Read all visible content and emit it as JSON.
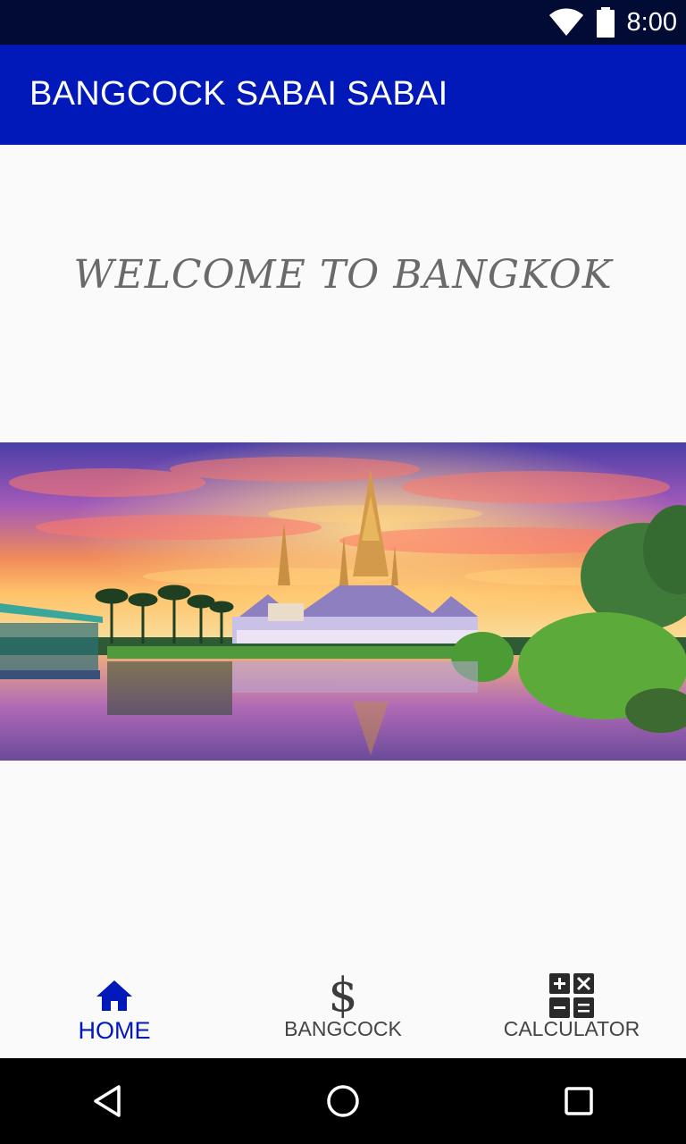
{
  "status_bar": {
    "time": "8:00",
    "icons": [
      "wifi-icon",
      "battery-icon"
    ]
  },
  "app_bar": {
    "title": "BANGCOCK SABAI SABAI",
    "color": "#0019b8"
  },
  "main": {
    "welcome_text": "WELCOME TO BANGKOK",
    "hero_image": "temple-at-sunset-photo"
  },
  "bottom_nav": {
    "items": [
      {
        "label": "HOME",
        "icon": "home-icon",
        "active": true
      },
      {
        "label": "BANGCOCK",
        "icon": "dollar-icon",
        "active": false
      },
      {
        "label": "CALCULATOR",
        "icon": "calculator-icon",
        "active": false
      }
    ],
    "active_color": "#0019b8"
  },
  "system_nav": {
    "buttons": [
      "back-icon",
      "home-circle-icon",
      "recents-icon"
    ]
  }
}
